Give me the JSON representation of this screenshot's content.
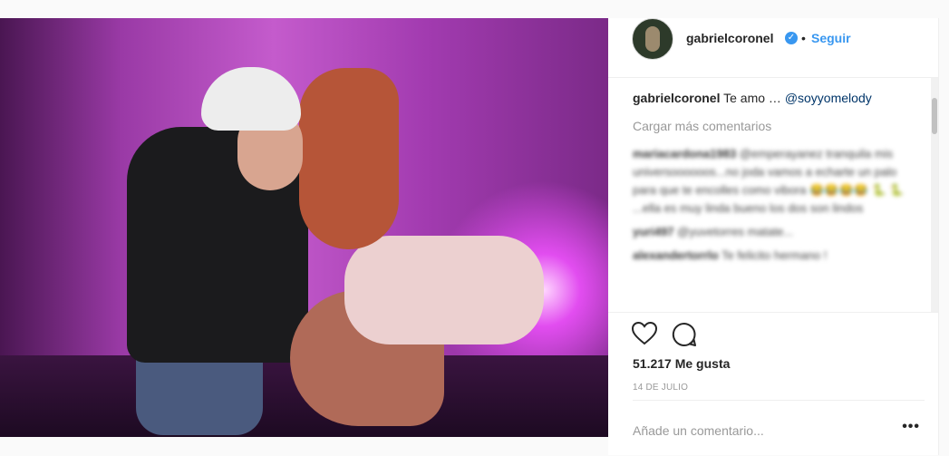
{
  "post": {
    "image_alt": "photo"
  },
  "header": {
    "username": "gabrielcoronel",
    "verified_glyph": "✓",
    "separator": "•",
    "follow_label": "Seguir",
    "avatar_icon": "avatar-photo"
  },
  "caption": {
    "username": "gabrielcoronel",
    "text": "Te amo …",
    "mention": "@soyyomelody"
  },
  "comments": {
    "load_more": "Cargar más comentarios",
    "blurred": [
      {
        "user": "mariacardona1983",
        "text": "@emperayanez tranquila mis universoooooos...no joda vamos a echarte un palo para que te encolles como vibora 😂😂😂😂 🐍 🐍 ...ella es muy linda bueno los dos son lindos"
      },
      {
        "user": "yuri497",
        "text": "@yuvetorres matate..."
      },
      {
        "user": "alexandertorrlo",
        "text": "Te felicito hermano !"
      }
    ]
  },
  "actions": {
    "like_icon": "heart-icon",
    "comment_icon": "comment-icon"
  },
  "likes": "51.217 Me gusta",
  "date": "14 DE JULIO",
  "add_comment": {
    "placeholder": "Añade un comentario...",
    "more_label": "•••"
  }
}
